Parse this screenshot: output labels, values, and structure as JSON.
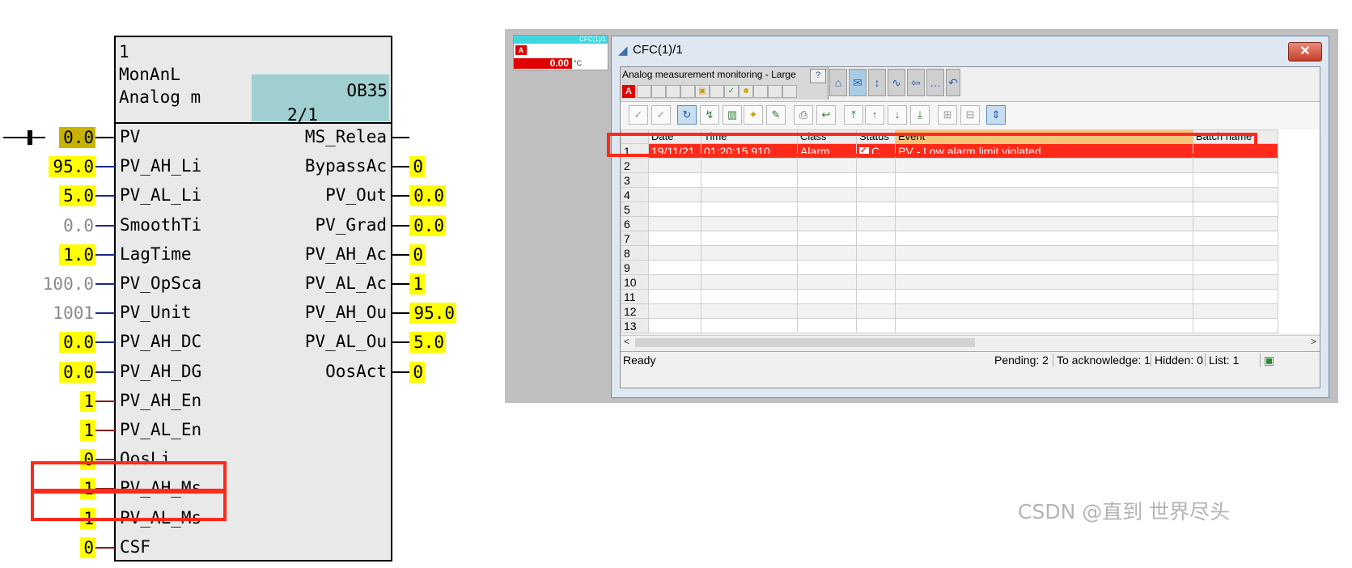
{
  "block": {
    "header": [
      "1",
      "MonAnL",
      "Analog m"
    ],
    "task": "OB35",
    "order": "2/1",
    "inputs": [
      {
        "name": "PV",
        "value": "0.0",
        "style": "olive"
      },
      {
        "name": "PV_AH_Li",
        "value": "95.0",
        "style": "yel"
      },
      {
        "name": "PV_AL_Li",
        "value": "5.0",
        "style": "yel"
      },
      {
        "name": "SmoothTi",
        "value": "0.0",
        "style": "plain"
      },
      {
        "name": "LagTime",
        "value": "1.0",
        "style": "yel"
      },
      {
        "name": "PV_OpSca",
        "value": "100.0",
        "style": "plain"
      },
      {
        "name": "PV_Unit",
        "value": "1001",
        "style": "plain"
      },
      {
        "name": "PV_AH_DC",
        "value": "0.0",
        "style": "yel"
      },
      {
        "name": "PV_AH_DG",
        "value": "0.0",
        "style": "yel"
      },
      {
        "name": "PV_AH_En",
        "value": "1",
        "style": "yel"
      },
      {
        "name": "PV_AL_En",
        "value": "1",
        "style": "yel"
      },
      {
        "name": "OosLi",
        "value": "0",
        "style": "yel"
      },
      {
        "name": "PV_AH_Ms",
        "value": "1",
        "style": "yel"
      },
      {
        "name": "PV_AL_Ms",
        "value": "1",
        "style": "yel"
      },
      {
        "name": "CSF",
        "value": "0",
        "style": "yel"
      }
    ],
    "outputs": [
      {
        "name": "MS_Relea",
        "value": ""
      },
      {
        "name": "BypassAc",
        "value": "0"
      },
      {
        "name": "PV_Out",
        "value": "0.0"
      },
      {
        "name": "PV_Grad",
        "value": "0.0"
      },
      {
        "name": "PV_AH_Ac",
        "value": "0"
      },
      {
        "name": "PV_AL_Ac",
        "value": "1"
      },
      {
        "name": "PV_AH_Ou",
        "value": "95.0"
      },
      {
        "name": "PV_AL_Ou",
        "value": "5.0"
      },
      {
        "name": "OosAct",
        "value": "0"
      }
    ]
  },
  "mini_faceplate": {
    "tag": "CFC(1)/1",
    "value": "0.00",
    "unit": "°C",
    "alarm_letter": "A"
  },
  "window": {
    "title": "CFC(1)/1",
    "close_label": "✕",
    "faceplate_title": "Analog measurement monitoring - Large",
    "alarm_letter": "A",
    "columns": [
      "",
      "Date",
      "Time",
      "Class",
      "Status",
      "Event",
      "Batch name"
    ],
    "rows": [
      {
        "n": "1",
        "date": "19/11/21",
        "time": "01:20:15.910",
        "class": "Alarm",
        "status": "C",
        "event": "PV - Low alarm limit violated"
      },
      {
        "n": "2"
      },
      {
        "n": "3"
      },
      {
        "n": "4"
      },
      {
        "n": "5"
      },
      {
        "n": "6"
      },
      {
        "n": "7"
      },
      {
        "n": "8"
      },
      {
        "n": "9"
      },
      {
        "n": "10"
      },
      {
        "n": "11"
      },
      {
        "n": "12"
      },
      {
        "n": "13"
      }
    ],
    "status": {
      "ready": "Ready",
      "pending": "Pending: 2",
      "to_ack": "To acknowledge: 1",
      "hidden": "Hidden: 0",
      "list": "List: 1"
    }
  },
  "colors": {
    "alarm": "#ff2a1a",
    "value_bg": "#ffff00",
    "wire_red": "#8b1a1a",
    "wire_blue": "#1a2a8b"
  },
  "watermark": "CSDN @直到 世界尽头"
}
